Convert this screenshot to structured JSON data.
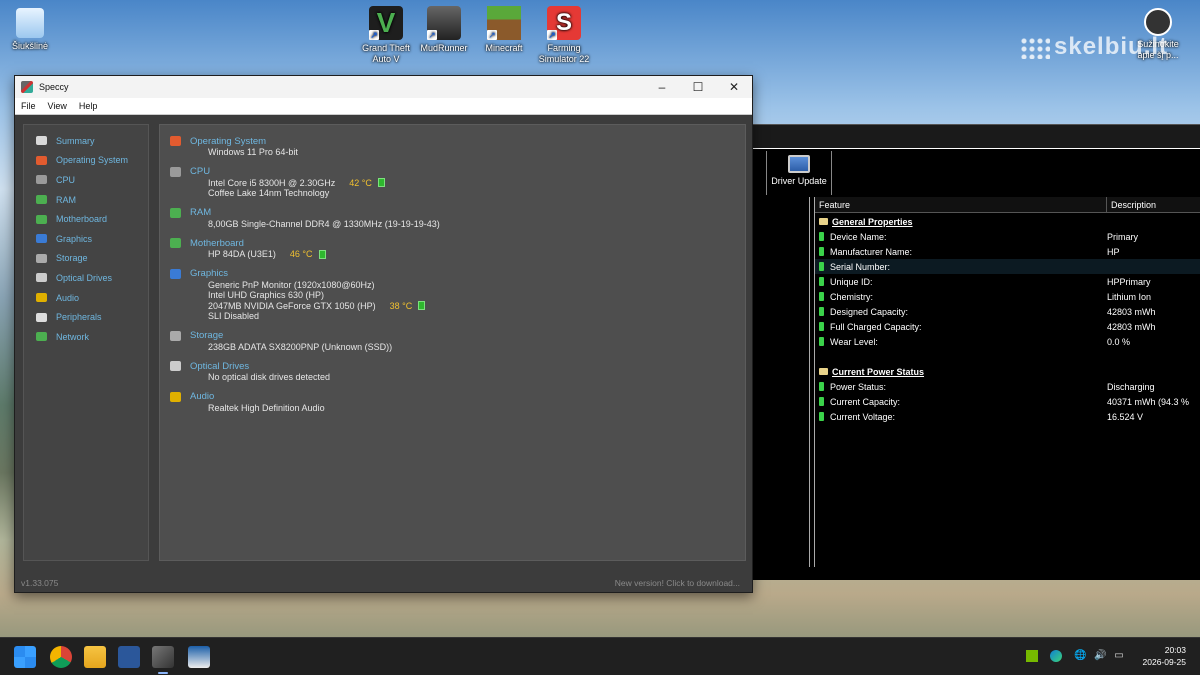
{
  "desktop": {
    "recycle_bin": "Šiukšlinė",
    "icons": [
      {
        "label": "Grand Theft Auto V"
      },
      {
        "label": "MudRunner"
      },
      {
        "label": "Minecraft"
      },
      {
        "label": "Farming Simulator 22"
      }
    ],
    "right_icon": "Sužinokite apie šį p...",
    "watermark": "skelbiu.lt"
  },
  "battery_window": {
    "toolbar_label": "Driver Update",
    "columns": [
      "Feature",
      "Description"
    ],
    "rows": [
      {
        "type": "section",
        "feature": "General Properties",
        "value": ""
      },
      {
        "type": "item",
        "feature": "Device Name:",
        "value": "Primary"
      },
      {
        "type": "item",
        "feature": "Manufacturer Name:",
        "value": "HP"
      },
      {
        "type": "item",
        "feature": "Serial Number:",
        "value": "",
        "highlight": true
      },
      {
        "type": "item",
        "feature": "Unique ID:",
        "value": " HPPrimary"
      },
      {
        "type": "item",
        "feature": "Chemistry:",
        "value": "Lithium Ion"
      },
      {
        "type": "item",
        "feature": "Designed Capacity:",
        "value": "42803 mWh"
      },
      {
        "type": "item",
        "feature": "Full Charged Capacity:",
        "value": "42803 mWh"
      },
      {
        "type": "item",
        "feature": "Wear Level:",
        "value": "0.0 %"
      },
      {
        "type": "blank",
        "feature": "",
        "value": ""
      },
      {
        "type": "section",
        "feature": "Current Power Status",
        "value": ""
      },
      {
        "type": "item",
        "feature": "Power Status:",
        "value": "Discharging"
      },
      {
        "type": "item",
        "feature": "Current Capacity:",
        "value": "40371 mWh (94.3 %"
      },
      {
        "type": "item",
        "feature": "Current Voltage:",
        "value": "16.524 V"
      }
    ]
  },
  "speccy": {
    "title": "Speccy",
    "menu": [
      "File",
      "View",
      "Help"
    ],
    "nav": [
      {
        "label": "Summary",
        "color": "#d9d9d9"
      },
      {
        "label": "Operating System",
        "color": "#e25b2f"
      },
      {
        "label": "CPU",
        "color": "#9a9a9a"
      },
      {
        "label": "RAM",
        "color": "#4caf50"
      },
      {
        "label": "Motherboard",
        "color": "#4caf50"
      },
      {
        "label": "Graphics",
        "color": "#3a7bd5"
      },
      {
        "label": "Storage",
        "color": "#aaaaaa"
      },
      {
        "label": "Optical Drives",
        "color": "#cccccc"
      },
      {
        "label": "Audio",
        "color": "#e0b000"
      },
      {
        "label": "Peripherals",
        "color": "#dddddd"
      },
      {
        "label": "Network",
        "color": "#4caf50"
      }
    ],
    "sections": [
      {
        "title": "Operating System",
        "color": "#e25b2f",
        "lines": [
          {
            "text": "Windows 11 Pro 64-bit"
          }
        ]
      },
      {
        "title": "CPU",
        "color": "#9a9a9a",
        "lines": [
          {
            "text": "Intel Core i5 8300H @ 2.30GHz",
            "temp": "42 °C"
          },
          {
            "text": "Coffee Lake 14nm Technology"
          }
        ]
      },
      {
        "title": "RAM",
        "color": "#4caf50",
        "lines": [
          {
            "text": "8,00GB Single-Channel DDR4 @ 1330MHz (19-19-19-43)"
          }
        ]
      },
      {
        "title": "Motherboard",
        "color": "#4caf50",
        "lines": [
          {
            "text": "HP 84DA (U3E1)",
            "temp": "46 °C"
          }
        ]
      },
      {
        "title": "Graphics",
        "color": "#3a7bd5",
        "lines": [
          {
            "text": "Generic PnP Monitor (1920x1080@60Hz)"
          },
          {
            "text": "Intel UHD Graphics 630 (HP)"
          },
          {
            "text": "2047MB NVIDIA GeForce GTX 1050 (HP)",
            "temp": "38 °C"
          },
          {
            "text": "SLI Disabled"
          }
        ]
      },
      {
        "title": "Storage",
        "color": "#aaaaaa",
        "lines": [
          {
            "text": "238GB ADATA SX8200PNP (Unknown (SSD))"
          }
        ]
      },
      {
        "title": "Optical Drives",
        "color": "#cccccc",
        "lines": [
          {
            "text": "No optical disk drives detected"
          }
        ]
      },
      {
        "title": "Audio",
        "color": "#e0b000",
        "lines": [
          {
            "text": "Realtek High Definition Audio"
          }
        ]
      }
    ],
    "version": "v1.33.075",
    "update_link": "New version! Click to download..."
  },
  "taskbar": {
    "time": "20:03",
    "date": "2026-09-25"
  }
}
